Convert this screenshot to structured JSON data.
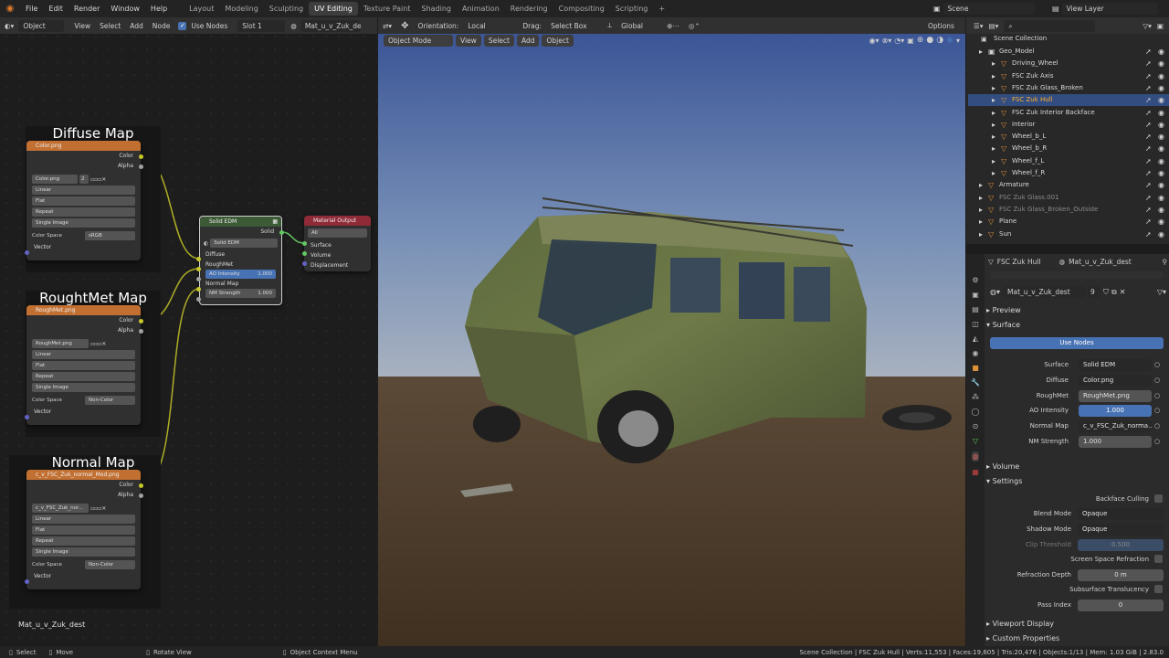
{
  "topbar": {
    "menus": [
      "File",
      "Edit",
      "Render",
      "Window",
      "Help"
    ],
    "workspaces": [
      "Layout",
      "Modeling",
      "Sculpting",
      "UV Editing",
      "Texture Paint",
      "Shading",
      "Animation",
      "Rendering",
      "Compositing",
      "Scripting"
    ],
    "active": "UV Editing",
    "plus": "+",
    "scene": "Scene",
    "view_layer": "View Layer"
  },
  "node_header": {
    "editor_type": "Object",
    "menus": [
      "View",
      "Select",
      "Add",
      "Node"
    ],
    "use_nodes": "Use Nodes",
    "slot": "Slot 1",
    "material": "Mat_u_v_Zuk_dest"
  },
  "viewport_header": {
    "orientation_label": "Orientation:",
    "orientation": "Local",
    "drag_label": "Drag:",
    "drag": "Select Box",
    "transform": "Global",
    "options": "Options",
    "mode": "Object Mode",
    "menus": [
      "View",
      "Select",
      "Add",
      "Object"
    ]
  },
  "frames": [
    {
      "label": "Diffuse Map",
      "texture_header": "Color.png",
      "image": "Color.png",
      "users": "2",
      "interp": "Linear",
      "proj": "Flat",
      "ext": "Repeat",
      "source": "Single Image",
      "cs_label": "Color Space",
      "cs": "sRGB"
    },
    {
      "label": "RoughtMet Map",
      "texture_header": "RoughMet.png",
      "image": "RoughMet.png",
      "users": "",
      "interp": "Linear",
      "proj": "Flat",
      "ext": "Repeat",
      "source": "Single Image",
      "cs_label": "Color Space",
      "cs": "Non-Color"
    },
    {
      "label": "Normal Map",
      "texture_header": "c_v_FSC_Zuk_normal_Mod.png",
      "image": "c_v_FSC_Zuk_nor...",
      "users": "",
      "interp": "Linear",
      "proj": "Flat",
      "ext": "Repeat",
      "source": "Single Image",
      "cs_label": "Color Space",
      "cs": "Non-Color"
    }
  ],
  "tex_sockets": {
    "color": "Color",
    "alpha": "Alpha",
    "vector": "Vector"
  },
  "group_node": {
    "title": "Solid EDM",
    "out": "Solid",
    "group": "Solid EDM",
    "inputs": [
      "Diffuse",
      "RoughMet"
    ],
    "ao_label": "AO Intensity",
    "ao": "1.000",
    "normal": "Normal Map",
    "nm_label": "NM Strength",
    "nm": "1.000"
  },
  "output_node": {
    "title": "Material Output",
    "target": "All",
    "inputs": [
      "Surface",
      "Volume",
      "Displacement"
    ]
  },
  "node_footer": "Mat_u_v_Zuk_dest",
  "outliner": {
    "root": "Scene Collection",
    "items": [
      {
        "name": "Geo_Model",
        "indent": 0,
        "selected": false
      },
      {
        "name": "Driving_Wheel",
        "indent": 1,
        "selected": false
      },
      {
        "name": "FSC Zuk Axis",
        "indent": 1,
        "selected": false
      },
      {
        "name": "FSC Zuk Glass_Broken",
        "indent": 1,
        "selected": false
      },
      {
        "name": "FSC Zuk Hull",
        "indent": 1,
        "selected": true
      },
      {
        "name": "FSC Zuk Interior Backface",
        "indent": 1,
        "selected": false
      },
      {
        "name": "Interior",
        "indent": 1,
        "selected": false
      },
      {
        "name": "Wheel_b_L",
        "indent": 1,
        "selected": false
      },
      {
        "name": "Wheel_b_R",
        "indent": 1,
        "selected": false
      },
      {
        "name": "Wheel_f_L",
        "indent": 1,
        "selected": false
      },
      {
        "name": "Wheel_f_R",
        "indent": 1,
        "selected": false
      },
      {
        "name": "Armature",
        "indent": 0,
        "selected": false
      },
      {
        "name": "FSC Zuk Glass.001",
        "indent": 0,
        "selected": false
      },
      {
        "name": "FSC Zuk Glass_Broken_Outside",
        "indent": 0,
        "selected": false
      },
      {
        "name": "Plane",
        "indent": 0,
        "selected": false
      },
      {
        "name": "Sun",
        "indent": 0,
        "selected": false
      }
    ]
  },
  "props": {
    "object": "FSC Zuk Hull",
    "material": "Mat_u_v_Zuk_dest",
    "mat_field": "Mat_u_v_Zuk_dest",
    "users": "9",
    "preview": "Preview",
    "surface_sec": "Surface",
    "use_nodes": "Use Nodes",
    "rows": [
      {
        "label": "Surface",
        "value": "Solid EDM",
        "style": "dark"
      },
      {
        "label": "Diffuse",
        "value": "Color.png",
        "style": "dark"
      },
      {
        "label": "RoughMet",
        "value": "RoughMet.png",
        "style": "grey"
      },
      {
        "label": "AO Intensity",
        "value": "1.000",
        "style": "blue"
      },
      {
        "label": "Normal Map",
        "value": "c_v_FSC_Zuk_norma...",
        "style": "dark"
      },
      {
        "label": "NM Strength",
        "value": "1.000",
        "style": "grey"
      }
    ],
    "volume": "Volume",
    "settings": "Settings",
    "backface": "Backface Culling",
    "blend_label": "Blend Mode",
    "blend": "Opaque",
    "shadow_label": "Shadow Mode",
    "shadow": "Opaque",
    "clip_label": "Clip Threshold",
    "clip": "0.500",
    "ssr": "Screen Space Refraction",
    "refr_label": "Refraction Depth",
    "refr": "0 m",
    "sss": "Subsurface Translucency",
    "pass_label": "Pass Index",
    "pass": "0",
    "viewport_display": "Viewport Display",
    "custom": "Custom Properties"
  },
  "status": {
    "select": "Select",
    "move": "Move",
    "rotate": "Rotate View",
    "context": "Object Context Menu",
    "info": "Scene Collection | FSC Zuk Hull | Verts:11,553 | Faces:19,605 | Tris:20,476 | Objects:1/13 | Mem: 1.03 GiB | 2.83.0"
  }
}
